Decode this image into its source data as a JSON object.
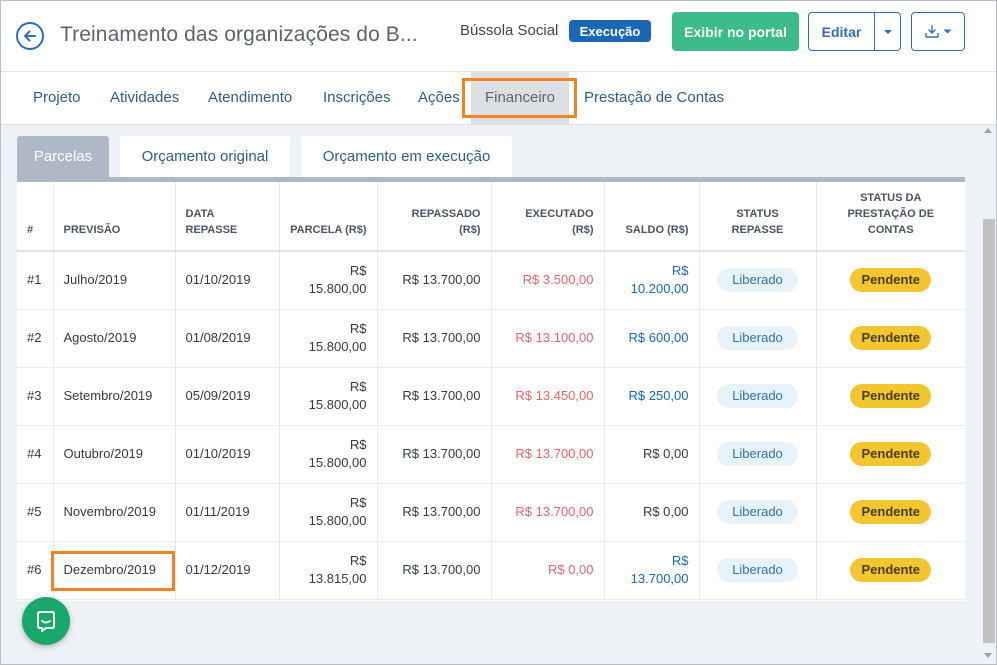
{
  "header": {
    "title": "Treinamento das organizações do B...",
    "org_name": "Bússola Social",
    "status_badge": "Execução",
    "portal_button": "Exibir no portal",
    "edit_button": "Editar"
  },
  "nav": {
    "items": [
      {
        "label": "Projeto"
      },
      {
        "label": "Atividades"
      },
      {
        "label": "Atendimento"
      },
      {
        "label": "Inscrições"
      },
      {
        "label": "Ações"
      },
      {
        "label": "Financeiro",
        "active": true
      },
      {
        "label": "Prestação de Contas"
      }
    ]
  },
  "subtabs": [
    {
      "label": "Parcelas",
      "active": true
    },
    {
      "label": "Orçamento original"
    },
    {
      "label": "Orçamento em execução"
    }
  ],
  "table": {
    "columns": [
      "#",
      "PREVISÃO",
      "DATA REPASSE",
      "PARCELA (R$)",
      "REPASSADO (R$)",
      "EXECUTADO (R$)",
      "SALDO (R$)",
      "STATUS REPASSE",
      "STATUS DA PRESTAÇÃO DE CONTAS"
    ],
    "rows": [
      {
        "num": "#1",
        "previsao": "Julho/2019",
        "data": "01/10/2019",
        "parcela": "R$ 15.800,00",
        "repassado": "R$ 13.700,00",
        "executado": "R$ 3.500,00",
        "saldo": "R$ 10.200,00",
        "status_repasse": "Liberado",
        "status_prestacao": "Pendente"
      },
      {
        "num": "#2",
        "previsao": "Agosto/2019",
        "data": "01/08/2019",
        "parcela": "R$ 15.800,00",
        "repassado": "R$ 13.700,00",
        "executado": "R$ 13.100,00",
        "saldo": "R$ 600,00",
        "status_repasse": "Liberado",
        "status_prestacao": "Pendente"
      },
      {
        "num": "#3",
        "previsao": "Setembro/2019",
        "data": "05/09/2019",
        "parcela": "R$ 15.800,00",
        "repassado": "R$ 13.700,00",
        "executado": "R$ 13.450,00",
        "saldo": "R$ 250,00",
        "status_repasse": "Liberado",
        "status_prestacao": "Pendente"
      },
      {
        "num": "#4",
        "previsao": "Outubro/2019",
        "data": "01/10/2019",
        "parcela": "R$ 15.800,00",
        "repassado": "R$ 13.700,00",
        "executado": "R$ 13.700,00",
        "saldo": "R$ 0,00",
        "status_repasse": "Liberado",
        "status_prestacao": "Pendente"
      },
      {
        "num": "#5",
        "previsao": "Novembro/2019",
        "data": "01/11/2019",
        "parcela": "R$ 15.800,00",
        "repassado": "R$ 13.700,00",
        "executado": "R$ 13.700,00",
        "saldo": "R$ 0,00",
        "status_repasse": "Liberado",
        "status_prestacao": "Pendente"
      },
      {
        "num": "#6",
        "previsao": "Dezembro/2019",
        "data": "01/12/2019",
        "parcela": "R$ 13.815,00",
        "repassado": "R$ 13.700,00",
        "executado": "R$ 0,00",
        "saldo": "R$ 13.700,00",
        "status_repasse": "Liberado",
        "status_prestacao": "Pendente"
      }
    ]
  },
  "icons": {
    "back": "arrow-left-icon",
    "caret": "caret-down-icon",
    "export": "export-icon",
    "chat": "chat-icon"
  },
  "colors": {
    "primary": "#1a67b3",
    "success": "#3dbc8b",
    "highlight": "#f28322",
    "negative": "#e4666b",
    "pending": "#f2c630"
  }
}
